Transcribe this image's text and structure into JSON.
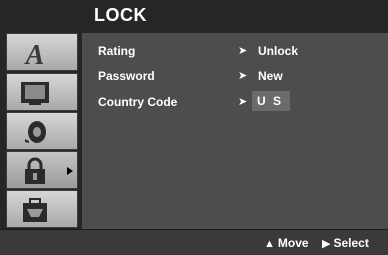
{
  "menu": {
    "title": "LOCK"
  },
  "tabs": [
    {
      "icon": "letter-a-icon",
      "glyph": "A"
    },
    {
      "icon": "tv-screen-icon"
    },
    {
      "icon": "speaker-icon"
    },
    {
      "icon": "padlock-icon",
      "selected": true
    },
    {
      "icon": "briefcase-icon"
    }
  ],
  "settings": [
    {
      "label": "Rating",
      "value": "Unlock"
    },
    {
      "label": "Password",
      "value": "New"
    },
    {
      "label": "Country Code",
      "value": "U S"
    }
  ],
  "footer": {
    "move_label": "Move",
    "select_label": "Select"
  },
  "colors": {
    "background": "#262626",
    "panel": "#4d4d4d",
    "tab": "#c0c0c0",
    "highlight": "#6b6b6b",
    "text": "#ffffff"
  }
}
